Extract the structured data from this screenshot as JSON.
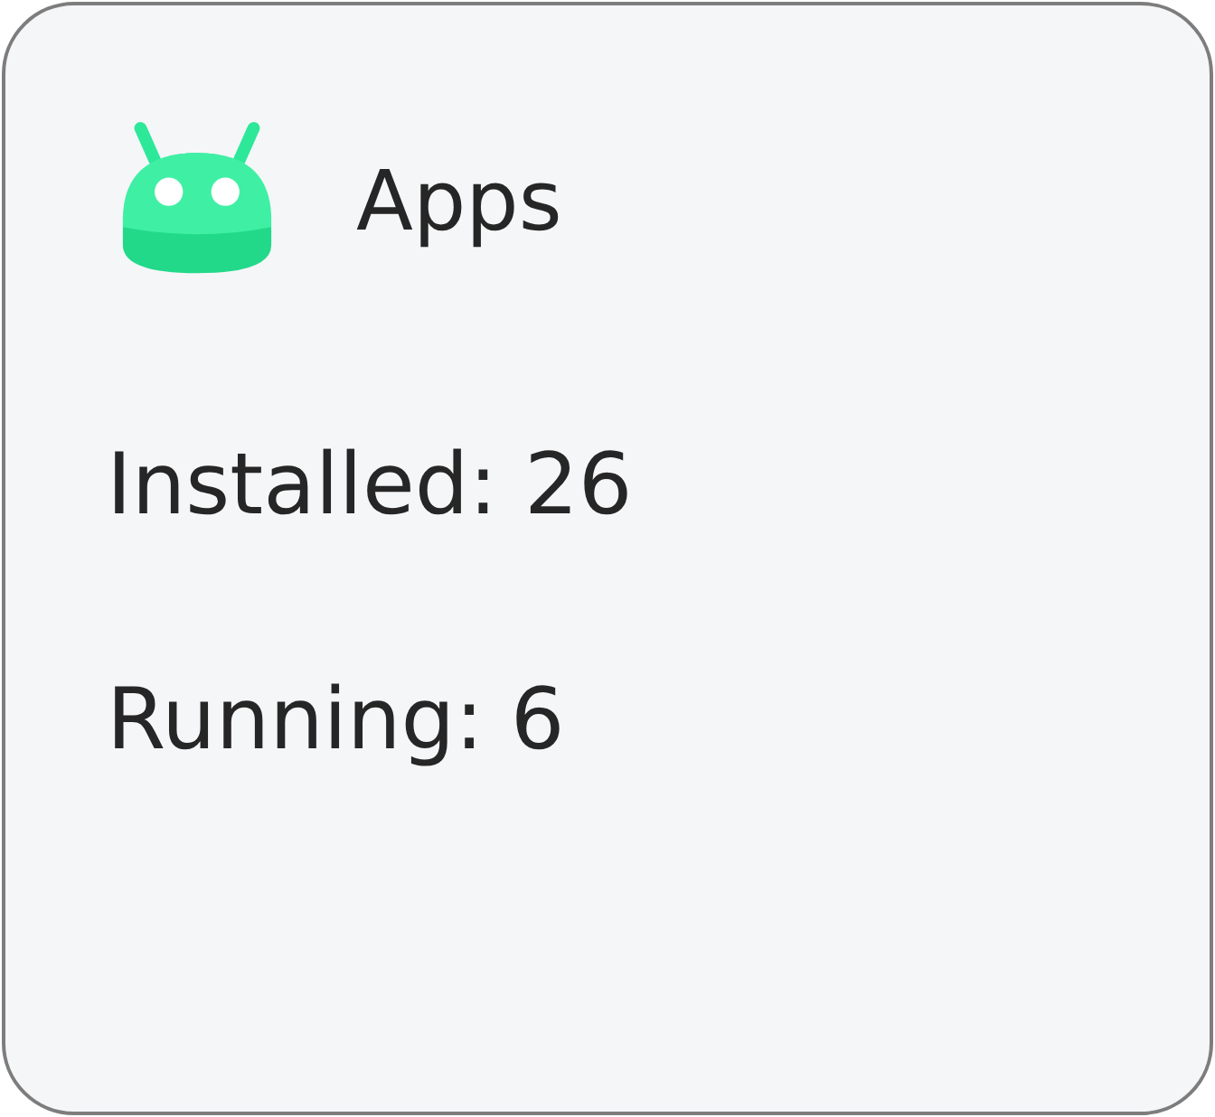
{
  "card": {
    "title": "Apps",
    "stats": [
      {
        "text": "Installed: 26"
      },
      {
        "text": "Running: 6"
      }
    ]
  }
}
